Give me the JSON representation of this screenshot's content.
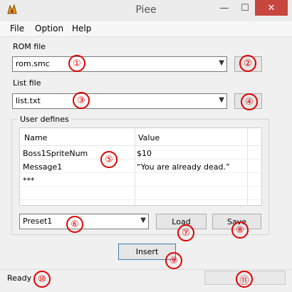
{
  "window": {
    "title": "Piee",
    "minimize": "—",
    "maximize": "☐",
    "close": "✕",
    "app_icon": "app-icon"
  },
  "menu": [
    {
      "label": "File"
    },
    {
      "label": "Option"
    },
    {
      "label": "Help"
    }
  ],
  "rom": {
    "label": "ROM file",
    "value": "rom.smc"
  },
  "list": {
    "label": "List file",
    "value": "list.txt"
  },
  "user_defines": {
    "legend": "User defines",
    "headers": [
      "Name",
      "Value"
    ],
    "rows": [
      {
        "name": "Boss1SpriteNum",
        "value": "$10"
      },
      {
        "name": "Message1",
        "value": "“You are already dead.”"
      },
      {
        "name": "***",
        "value": ""
      }
    ]
  },
  "preset": {
    "value": "Preset1",
    "load_label": "Load",
    "save_label": "Save"
  },
  "insert_label": "Insert",
  "status": {
    "text": "Ready"
  },
  "markers": {
    "m1": "①",
    "m2": "②",
    "m3": "③",
    "m4": "④",
    "m5": "⑤",
    "m6": "⑥",
    "m7": "⑦",
    "m8": "⑧",
    "m9": "⑨",
    "m10": "⑩",
    "m11": "⑪"
  },
  "colors": {
    "marker": "#e00000",
    "close_button": "#c7463e"
  }
}
